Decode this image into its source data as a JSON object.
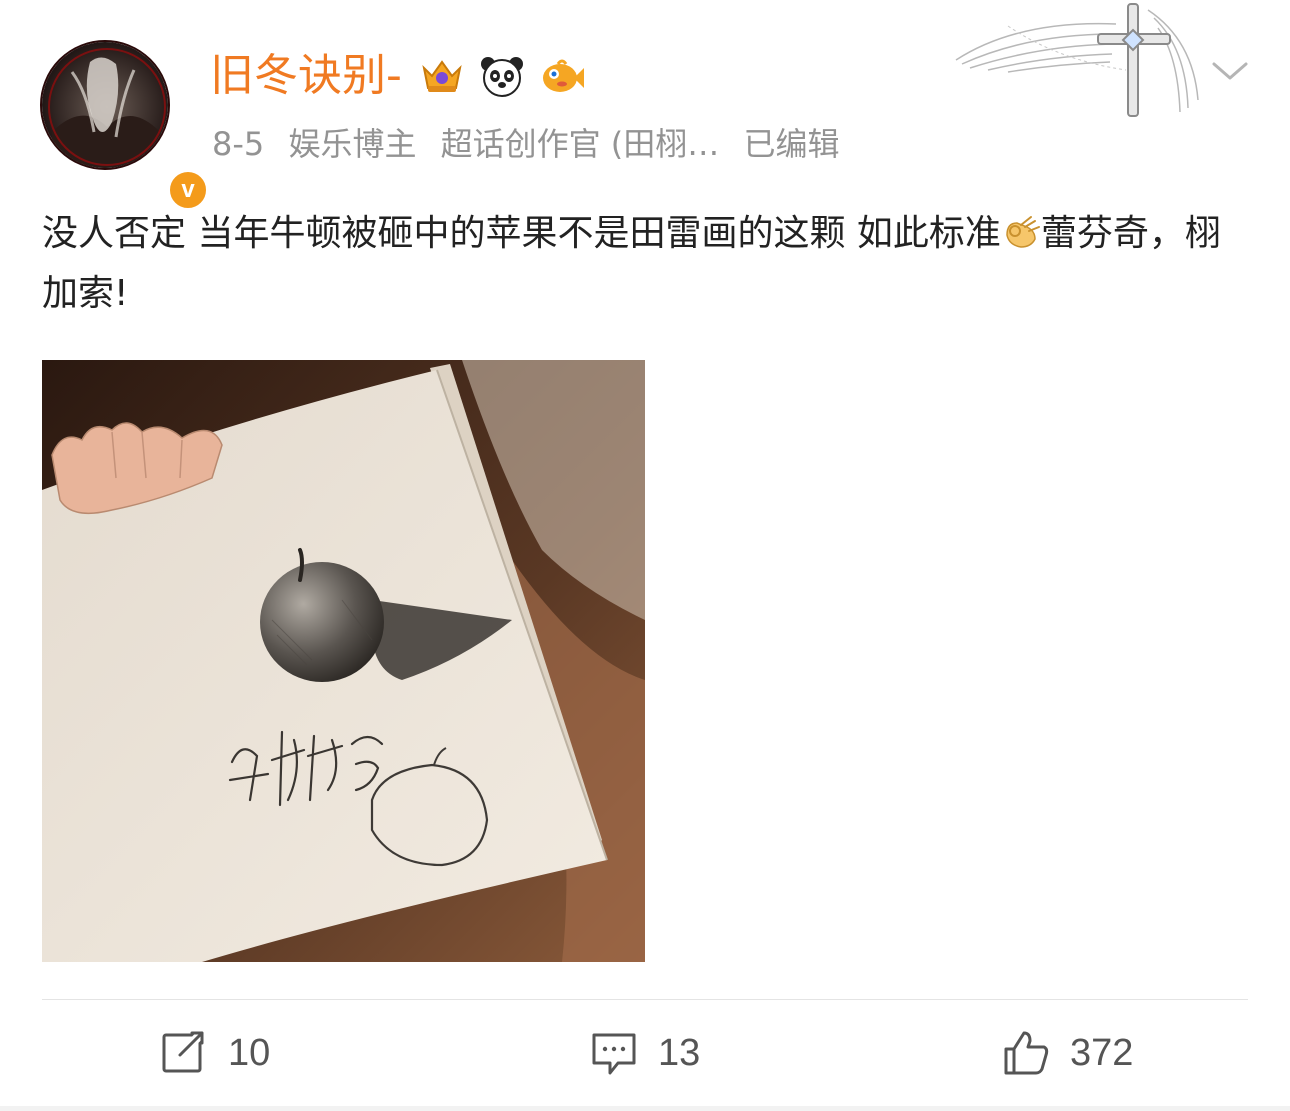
{
  "post": {
    "author": {
      "name": "旧冬诀别-",
      "verified_mark": "v",
      "badges": [
        "crown-vip-badge-icon",
        "panda-badge-icon",
        "fish-badge-icon"
      ]
    },
    "meta": {
      "date": "8-5",
      "tags": [
        "娱乐博主",
        "超话创作官 (田栩…"
      ],
      "edited": "已编辑"
    },
    "text_part1": "没人否定 当年牛顿被砸中的苹果不是田雷画的这颗 如此标准",
    "text_emoji": "ok-hand-emoji",
    "text_part2": "蕾芬奇，栩加索!",
    "image": {
      "description_icon": "sketchbook-photo",
      "signature_text": "田栩宁"
    },
    "actions": {
      "repost_count": "10",
      "comment_count": "13",
      "like_count": "372"
    }
  },
  "colors": {
    "username": "#f07a22",
    "meta": "#939393",
    "verified": "#f49b1b"
  }
}
